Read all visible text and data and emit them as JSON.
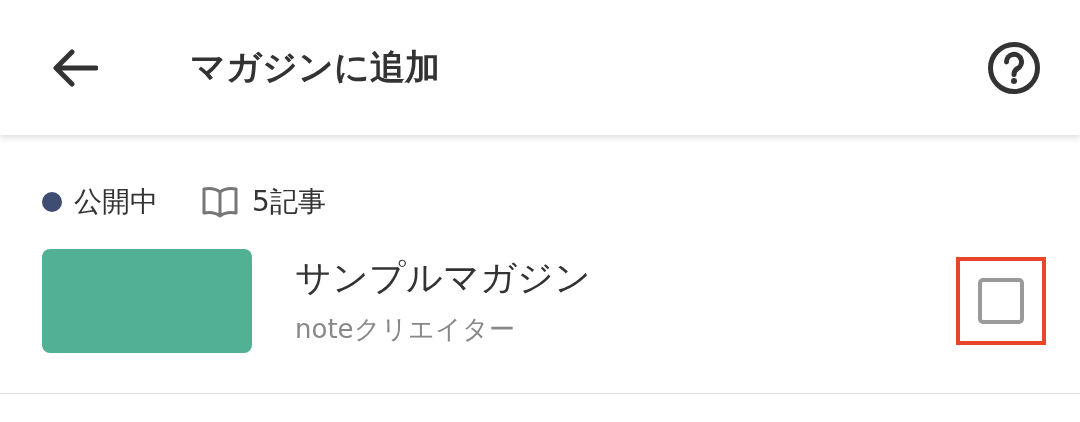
{
  "header": {
    "title": "マガジンに追加"
  },
  "magazine": {
    "status": {
      "label": "公開中",
      "color": "#3f4d72"
    },
    "article_count": "5記事",
    "title": "サンプルマガジン",
    "author": "noteクリエイター",
    "checked": false,
    "highlighted": true
  }
}
